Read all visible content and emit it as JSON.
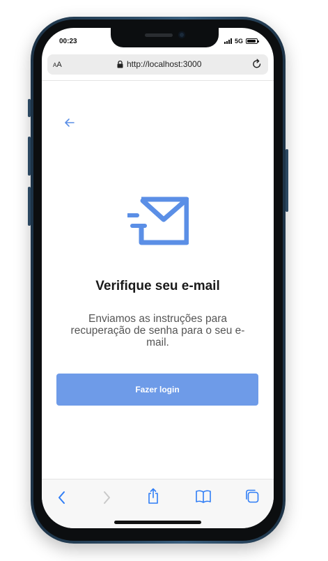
{
  "status_bar": {
    "time": "00:23",
    "network": "5G"
  },
  "browser": {
    "text_size_label_small": "A",
    "text_size_label_large": "A",
    "url": "http://localhost:3000"
  },
  "page": {
    "title": "Verifique seu e-mail",
    "message": "Enviamos as instruções para recuperação de senha para o seu e-mail.",
    "login_button_label": "Fazer login"
  },
  "colors": {
    "accent": "#6e9be8",
    "icon_blue": "#5b8fe6",
    "safari_blue": "#2f7df6"
  },
  "icons": {
    "back": "arrow-left-icon",
    "main": "envelope-sent-icon",
    "toolbar": [
      "chevron-left-icon",
      "chevron-right-icon",
      "share-icon",
      "bookmarks-icon",
      "tabs-icon"
    ]
  }
}
